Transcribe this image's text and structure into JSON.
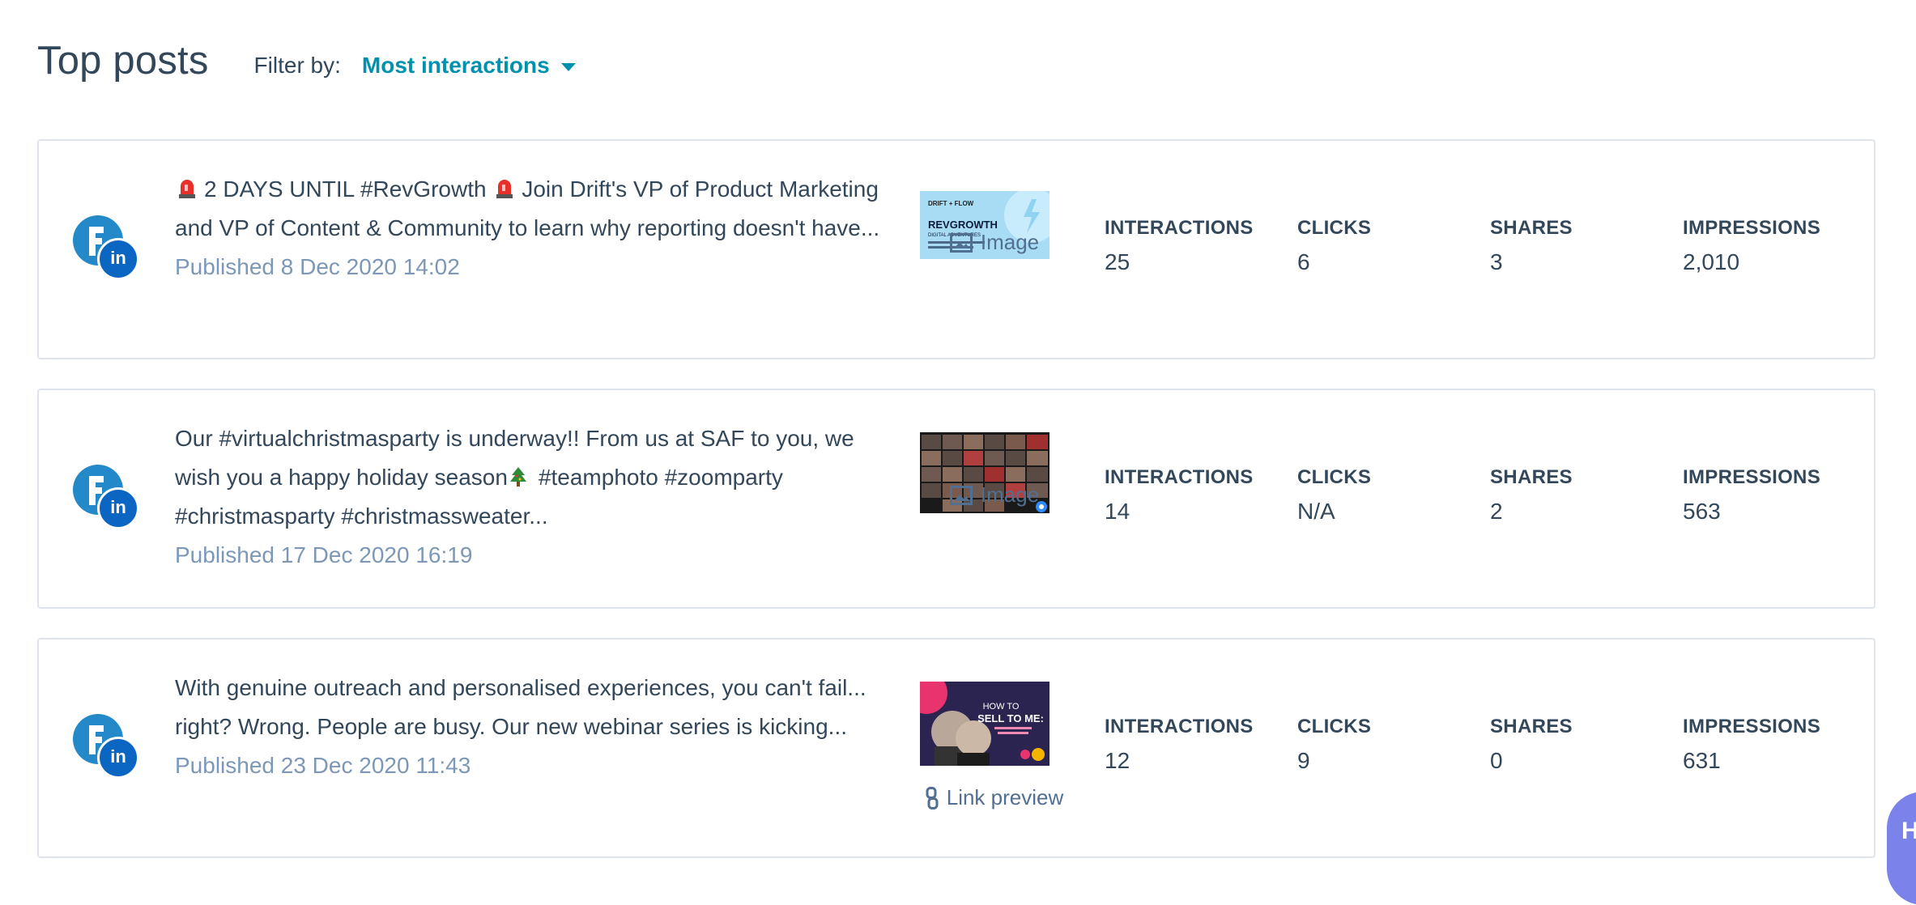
{
  "header": {
    "title": "Top posts",
    "filter_label": "Filter by:",
    "filter_value": "Most interactions"
  },
  "metric_labels": {
    "interactions": "INTERACTIONS",
    "clicks": "CLICKS",
    "shares": "SHARES",
    "impressions": "IMPRESSIONS"
  },
  "posts": [
    {
      "text_a": "2 DAYS UNTIL #RevGrowth",
      "text_b": "Join Drift's VP of Product Marketing and VP of Content & Community to learn why reporting doesn't have...",
      "published": "Published 8 Dec 2020 14:02",
      "media_type": "Image",
      "thumb_brand": "DRIFT + FLOW",
      "thumb_title": "REVGROWTH",
      "thumb_sub": "DIGITAL ADVENTURES",
      "interactions": "25",
      "clicks": "6",
      "shares": "3",
      "impressions": "2,010"
    },
    {
      "text_a": "Our #virtualchristmasparty is underway!! From us at SAF to you, we wish you a happy holiday season",
      "text_b": "#teamphoto #zoomparty #christmasparty #christmassweater...",
      "published": "Published 17 Dec 2020 16:19",
      "media_type": "Image",
      "interactions": "14",
      "clicks": "N/A",
      "shares": "2",
      "impressions": "563"
    },
    {
      "text_a": "With genuine outreach and personalised experiences, you can't fail... right? Wrong. People are busy. Our new webinar series is kicking...",
      "published": "Published 23 Dec 2020 11:43",
      "media_type": "Link preview",
      "thumb_line1": "HOW TO",
      "thumb_line2": "SELL TO ME:",
      "interactions": "12",
      "clicks": "9",
      "shares": "0",
      "impressions": "631"
    }
  ],
  "help": {
    "label": "H"
  },
  "icons": {
    "account": "social-account-icon",
    "network": "linkedin-icon",
    "image": "image-icon",
    "link": "link-icon",
    "alarm": "siren-emoji",
    "tree": "christmas-tree-emoji"
  },
  "colors": {
    "accent": "#0091ae",
    "text": "#33475b",
    "muted": "#7c98b6",
    "border": "#dfe3eb",
    "linkedin": "#0a66c2"
  }
}
